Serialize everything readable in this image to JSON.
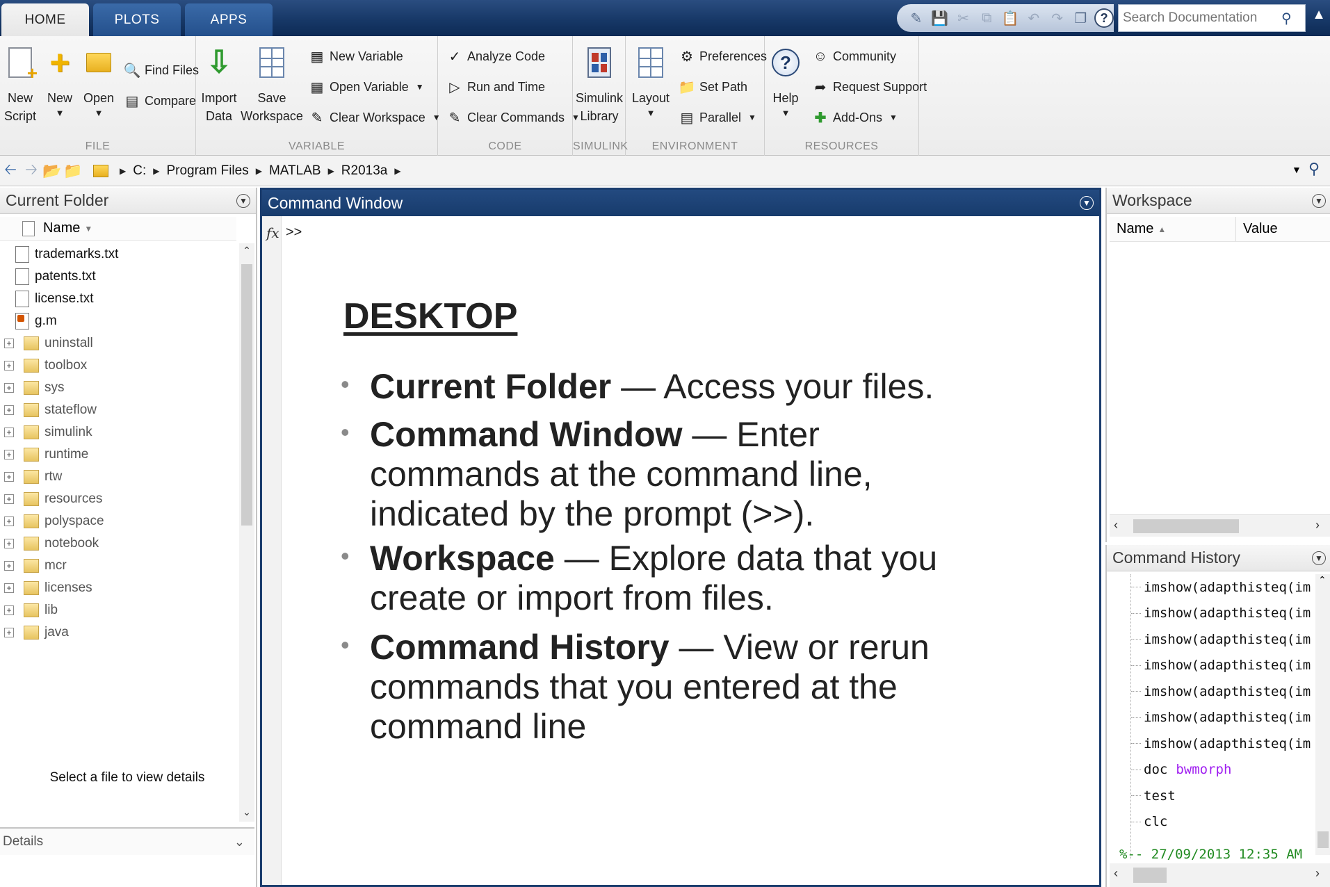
{
  "tabs": [
    {
      "label": "HOME"
    },
    {
      "label": "PLOTS"
    },
    {
      "label": "APPS"
    }
  ],
  "search": {
    "placeholder": "Search Documentation"
  },
  "ribbon": {
    "file": {
      "group_label": "FILE",
      "new_script": "New\nScript",
      "new": "New",
      "open": "Open",
      "find_files": "Find Files",
      "compare": "Compare"
    },
    "variable": {
      "group_label": "VARIABLE",
      "import_data": "Import\nData",
      "save_workspace": "Save\nWorkspace",
      "new_variable": "New Variable",
      "open_variable": "Open Variable",
      "clear_workspace": "Clear Workspace"
    },
    "code": {
      "group_label": "CODE",
      "analyze_code": "Analyze Code",
      "run_and_time": "Run and Time",
      "clear_commands": "Clear Commands"
    },
    "simulink": {
      "group_label": "SIMULINK",
      "simulink_library": "Simulink\nLibrary"
    },
    "environment": {
      "group_label": "ENVIRONMENT",
      "layout": "Layout",
      "preferences": "Preferences",
      "set_path": "Set Path",
      "parallel": "Parallel"
    },
    "resources": {
      "group_label": "RESOURCES",
      "help": "Help",
      "community": "Community",
      "request_support": "Request Support",
      "add_ons": "Add-Ons"
    }
  },
  "address": {
    "crumbs": [
      "C:",
      "Program Files",
      "MATLAB",
      "R2013a"
    ]
  },
  "current_folder": {
    "title": "Current Folder",
    "column_name": "Name",
    "items": [
      {
        "name": "trademarks.txt",
        "type": "txt"
      },
      {
        "name": "patents.txt",
        "type": "txt"
      },
      {
        "name": "license.txt",
        "type": "txt"
      },
      {
        "name": "g.m",
        "type": "m"
      },
      {
        "name": "uninstall",
        "type": "dir"
      },
      {
        "name": "toolbox",
        "type": "dir"
      },
      {
        "name": "sys",
        "type": "dir"
      },
      {
        "name": "stateflow",
        "type": "dir"
      },
      {
        "name": "simulink",
        "type": "dir"
      },
      {
        "name": "runtime",
        "type": "dir"
      },
      {
        "name": "rtw",
        "type": "dir"
      },
      {
        "name": "resources",
        "type": "dir"
      },
      {
        "name": "polyspace",
        "type": "dir"
      },
      {
        "name": "notebook",
        "type": "dir"
      },
      {
        "name": "mcr",
        "type": "dir"
      },
      {
        "name": "licenses",
        "type": "dir"
      },
      {
        "name": "lib",
        "type": "dir"
      },
      {
        "name": "java",
        "type": "dir"
      }
    ],
    "details_label": "Details",
    "details_text": "Select a file to view details"
  },
  "command_window": {
    "title": "Command Window",
    "fx": "fx",
    "prompt": ">>"
  },
  "slide": {
    "heading": "DESKTOP",
    "bullets": [
      {
        "term": "Current Folder",
        "desc": " — Access your files."
      },
      {
        "term": "Command Window",
        "desc": " — Enter commands at the command line, indicated by the prompt (>>)."
      },
      {
        "term": "Workspace",
        "desc": " — Explore data that you create or import from files."
      },
      {
        "term": "Command History",
        "desc": " — View or rerun commands that you entered at the command line"
      }
    ]
  },
  "workspace": {
    "title": "Workspace",
    "col_name": "Name",
    "col_value": "Value"
  },
  "command_history": {
    "title": "Command History",
    "entries": [
      {
        "cmd": "imshow(adapthisteq(im"
      },
      {
        "cmd": "imshow(adapthisteq(im"
      },
      {
        "cmd": "imshow(adapthisteq(im"
      },
      {
        "cmd": "imshow(adapthisteq(im"
      },
      {
        "cmd": "imshow(adapthisteq(im"
      },
      {
        "cmd": "imshow(adapthisteq(im"
      },
      {
        "cmd": "imshow(adapthisteq(im"
      },
      {
        "cmd": "doc",
        "arg": "bwmorph"
      },
      {
        "cmd": "test"
      },
      {
        "cmd": "clc"
      }
    ],
    "session": "%-- 27/09/2013 12:35 AM"
  }
}
